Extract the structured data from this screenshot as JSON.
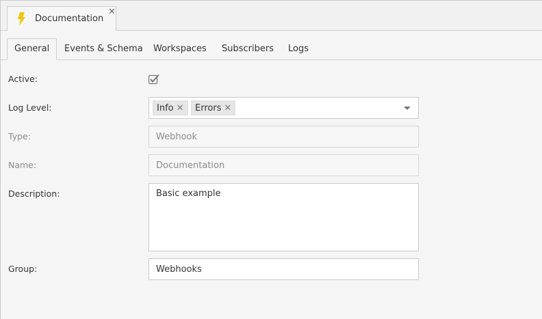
{
  "doc_tab": {
    "label": "Documentation",
    "icon": "lightning-bolt-icon",
    "close_label": "✕",
    "icon_color": "#f5c400"
  },
  "subtabs": [
    {
      "label": "General",
      "active": true
    },
    {
      "label": "Events & Schema",
      "active": false
    },
    {
      "label": "Workspaces",
      "active": false
    },
    {
      "label": "Subscribers",
      "active": false
    },
    {
      "label": "Logs",
      "active": false
    }
  ],
  "form": {
    "active": {
      "label": "Active:",
      "checked": true
    },
    "log_level": {
      "label": "Log Level:",
      "tags": [
        "Info",
        "Errors"
      ],
      "remove_label": "✕"
    },
    "type": {
      "label": "Type:",
      "value": "Webhook"
    },
    "name": {
      "label": "Name:",
      "value": "Documentation"
    },
    "description": {
      "label": "Description:",
      "value": "Basic example"
    },
    "group": {
      "label": "Group:",
      "value": "Webhooks"
    }
  }
}
